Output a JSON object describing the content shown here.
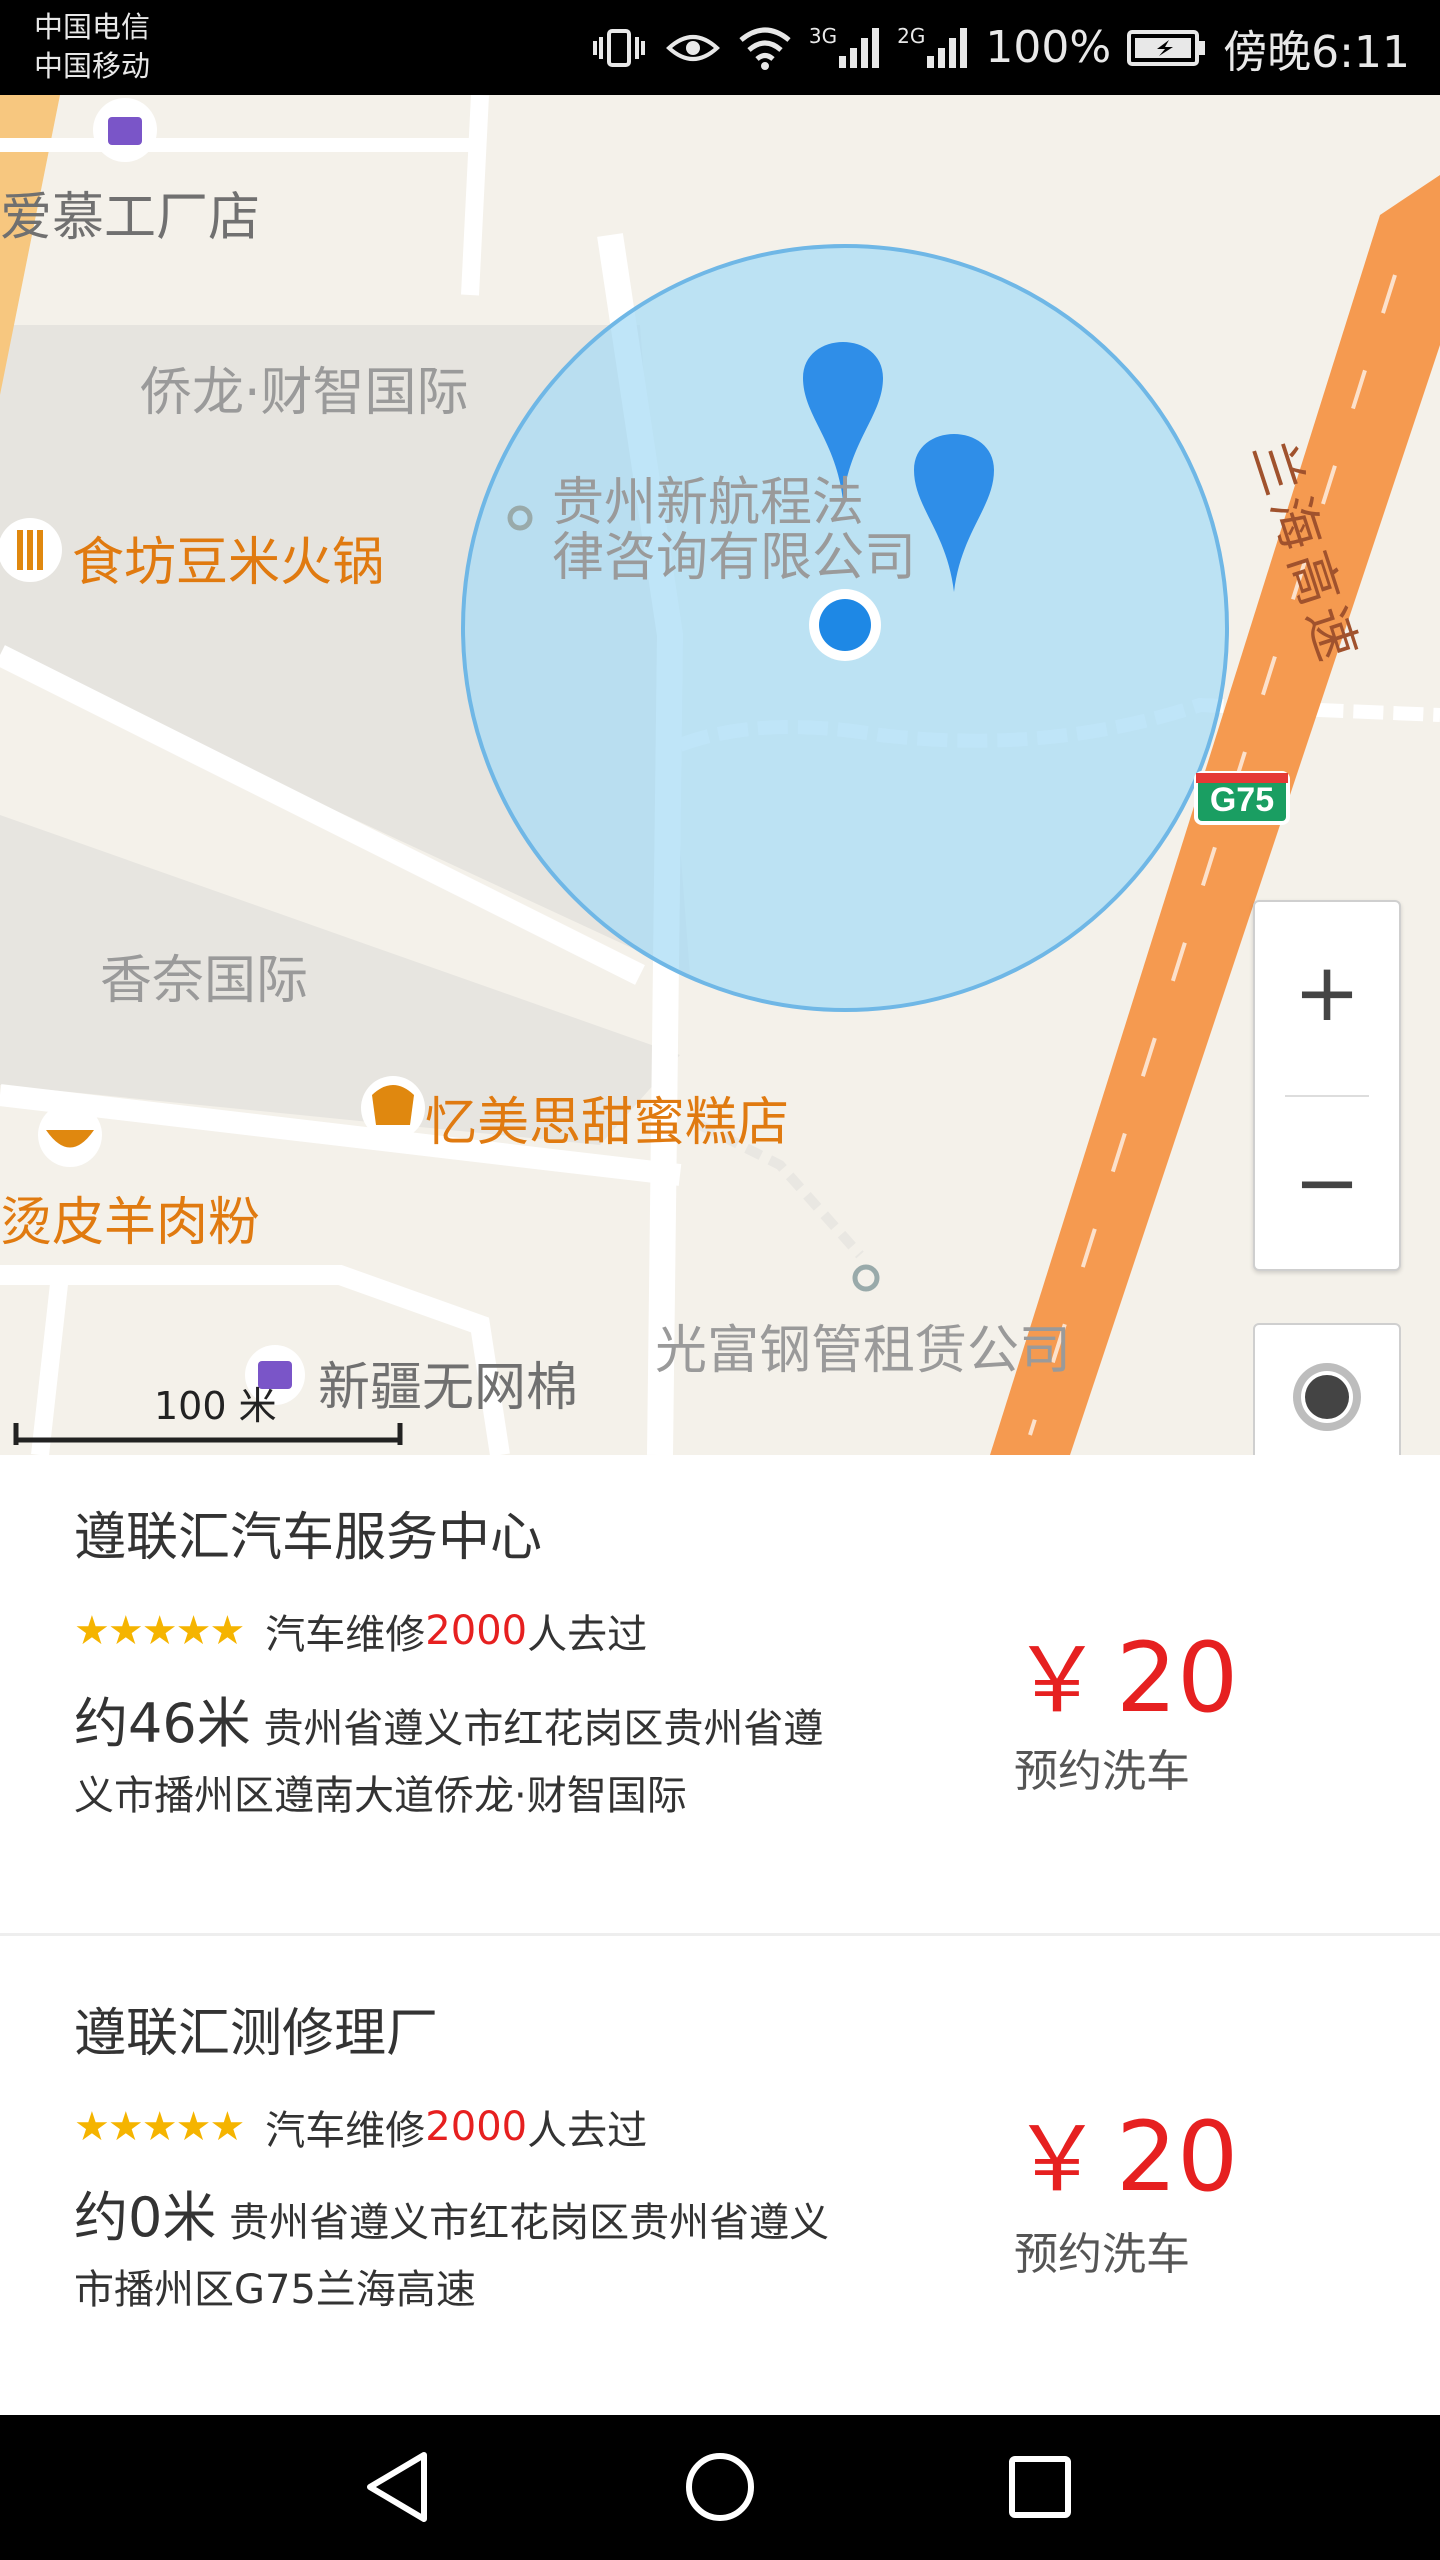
{
  "status_bar": {
    "carrier1": "中国电信",
    "carrier2": "中国移动",
    "net1": "3G",
    "net2": "2G",
    "battery": "100%",
    "time": "傍晚6:11",
    "icons": [
      "vibrate-icon",
      "eye-icon",
      "wifi-icon",
      "signal-icon",
      "battery-charging-icon"
    ]
  },
  "map": {
    "labels": {
      "aimu": "爱慕工厂店",
      "qiaolong": "侨龙·财智国际",
      "law_line1": "贵州新航程法",
      "law_line2": "律咨询有限公司",
      "hotpot": "食坊豆米火锅",
      "xiangnai": "香奈国际",
      "cake": "忆美思甜蜜糕店",
      "noodle": "烫皮羊肉粉",
      "guangfu": "光富钢管租赁公司",
      "xinjiang": "新疆无网棉",
      "highway": "兰海高速",
      "g75": "G75"
    },
    "scale_label": "100 米",
    "zoom_in": "+",
    "zoom_out": "−",
    "colors": {
      "accuracy_circle": "#a9dcf5",
      "marker": "#2f8ee8",
      "highway": "#f59a50"
    }
  },
  "shops": [
    {
      "name": "遵联汇汽车服务中心",
      "stars": "★★★★★",
      "category": "汽车维修",
      "visits": "2000",
      "visits_suffix": "人去过",
      "distance": "约46米",
      "address": "贵州省遵义市红花岗区贵州省遵义市播州区遵南大道侨龙·财智国际",
      "currency": "￥",
      "price": "20",
      "action": "预约洗车"
    },
    {
      "name": "遵联汇测修理厂",
      "stars": "★★★★★",
      "category": "汽车维修",
      "visits": "2000",
      "visits_suffix": "人去过",
      "distance": "约0米",
      "address": "贵州省遵义市红花岗区贵州省遵义市播州区G75兰海高速",
      "currency": "￥",
      "price": "20",
      "action": "预约洗车"
    }
  ],
  "nav_bar": {
    "icons": [
      "back-icon",
      "home-icon",
      "recents-icon"
    ]
  }
}
